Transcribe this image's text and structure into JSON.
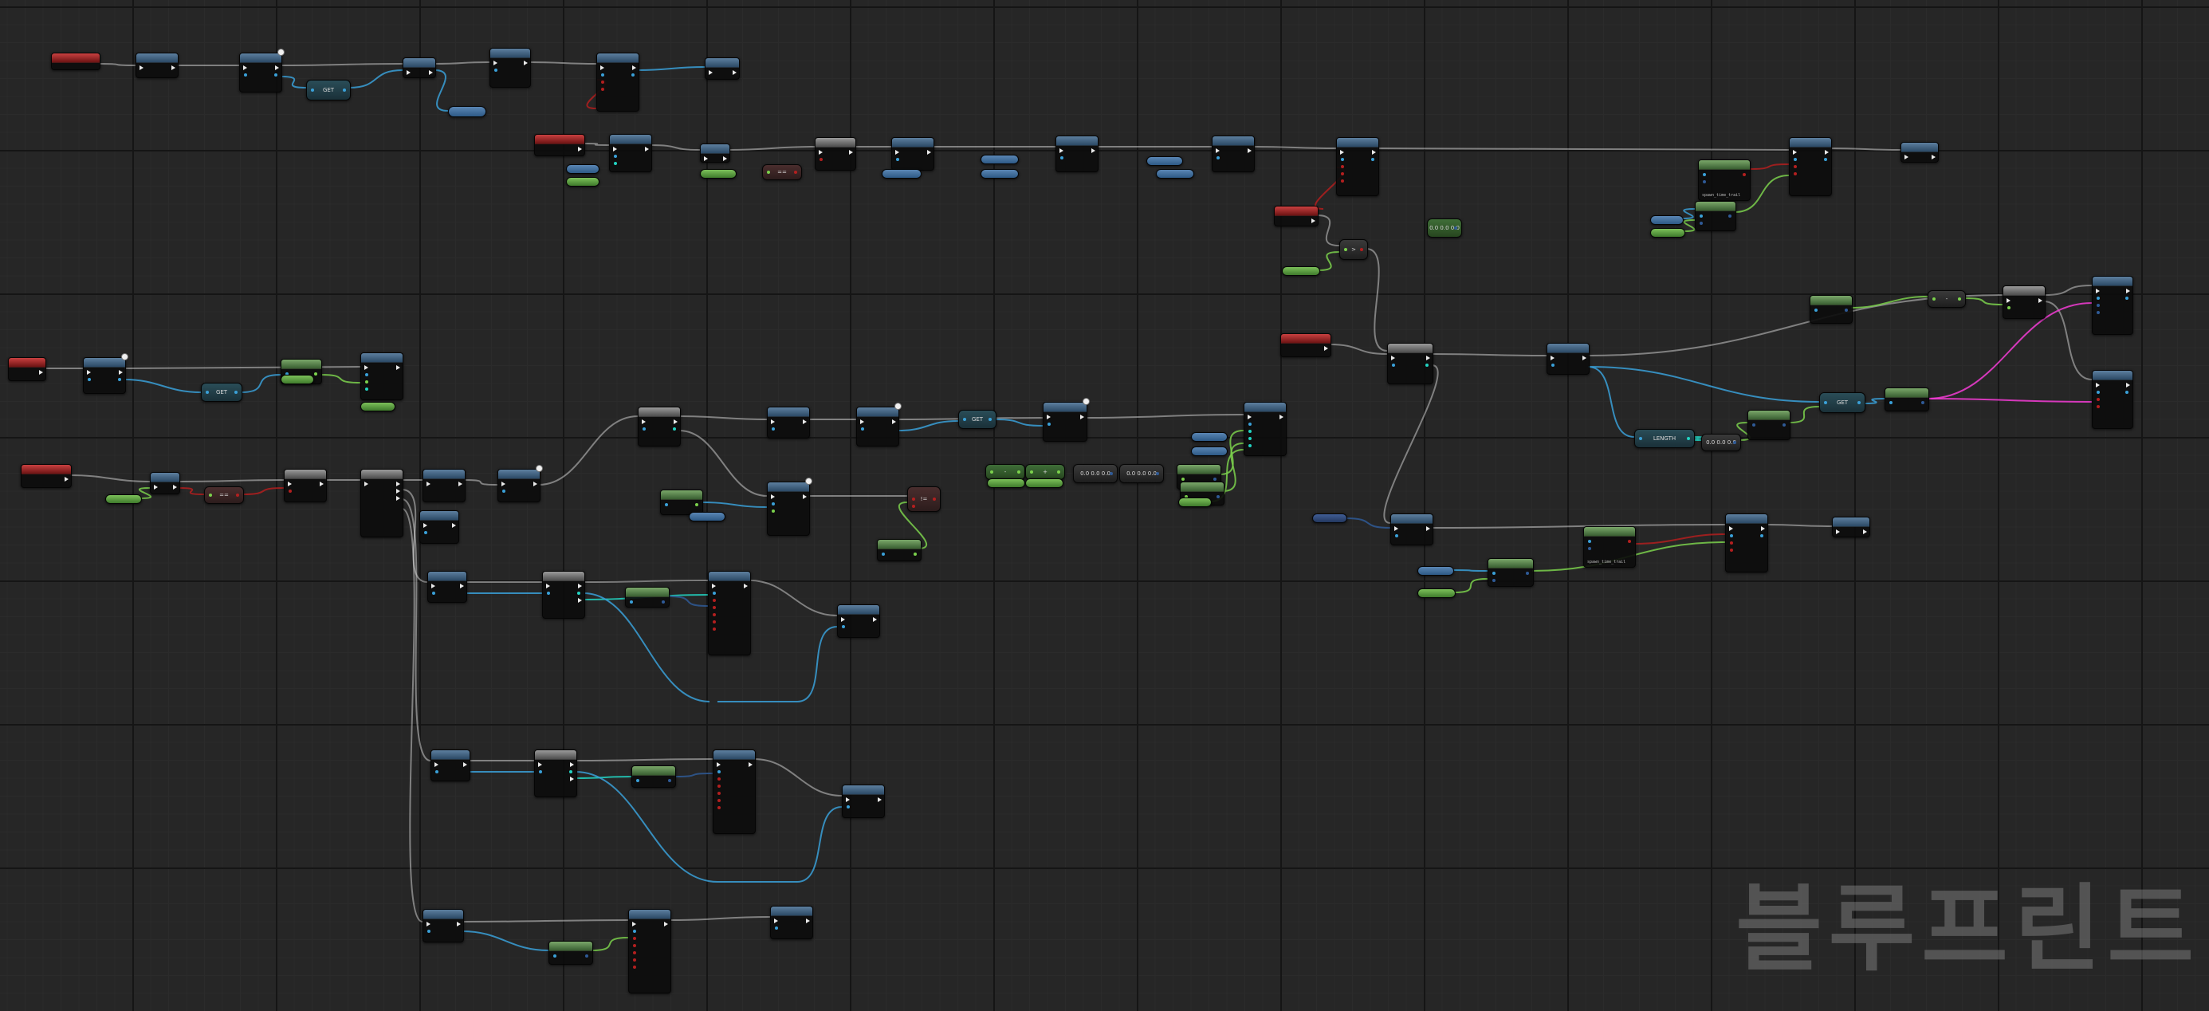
{
  "window": {
    "title": ""
  },
  "editor": {
    "type": "blueprint-event-graph"
  },
  "colors": {
    "exec": "#e8e8e8",
    "event_header": "#b32a2a",
    "function_header": "#3e6386",
    "pure_header": "#5e8c4e",
    "macro_header": "#7a7a7a",
    "object_pin": "#3aa0d8",
    "bool_pin": "#b31f1f",
    "float_pin": "#7bd14c",
    "int_pin": "#22d3c2",
    "struct_pin": "#2f5a96",
    "string_pin": "#f53cd6"
  },
  "labels": {
    "get": "GET",
    "length": "LENGTH",
    "equals": "==",
    "not_equal": "!=",
    "greater": ">",
    "less": "<",
    "and": "AND",
    "minus": "-",
    "plus": "+",
    "zero_vector": "0.0 0.0 0.0",
    "spawn_params": "spawn_time_trail"
  },
  "watermark": {
    "text": "블루프린트"
  }
}
